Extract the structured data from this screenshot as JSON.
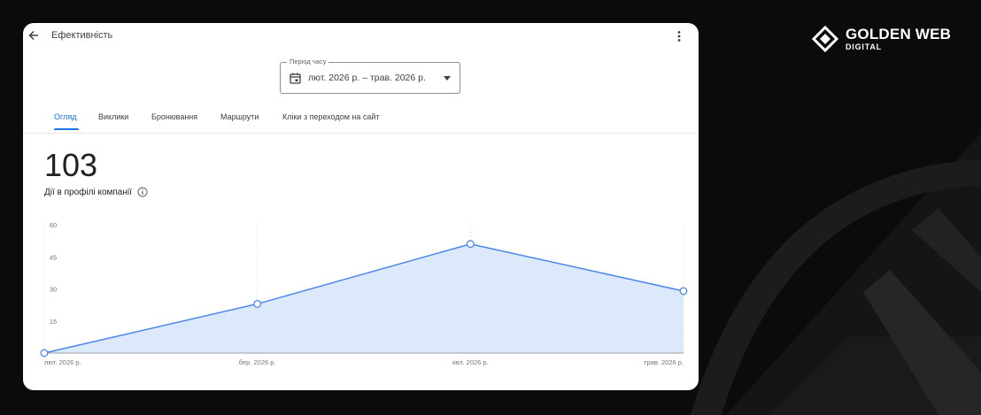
{
  "page": {
    "title": "Ефективність",
    "back_icon": "arrow-back-icon",
    "more_icon": "more-vert-icon"
  },
  "period": {
    "label": "Період часу",
    "value": "лют. 2026 р. – трав. 2026 р.",
    "icon": "calendar-icon",
    "caret": "dropdown-caret-icon"
  },
  "tabs": [
    {
      "label": "Огляд",
      "active": true
    },
    {
      "label": "Виклики",
      "active": false
    },
    {
      "label": "Бронювання",
      "active": false
    },
    {
      "label": "Маршрути",
      "active": false
    },
    {
      "label": "Кліки з переходом на сайт",
      "active": false
    }
  ],
  "metric": {
    "value": "103",
    "label": "Дії в профілі компанії",
    "info_icon": "info-icon"
  },
  "brand": {
    "name": "GOLDEN WEB",
    "sub": "DIGITAL"
  },
  "colors": {
    "accent": "#1a73e8",
    "line": "#4a86e8",
    "area_fill": "#dce9fb",
    "card_bg": "#ffffff",
    "page_bg": "#0b0b0b"
  },
  "chart_data": {
    "type": "area",
    "categories": [
      "лют. 2026 р.",
      "бер. 2026 р.",
      "квіт. 2026 р.",
      "трав. 2026 р."
    ],
    "values": [
      0,
      23,
      51,
      29
    ],
    "ylim": [
      0,
      60
    ],
    "yticks": [
      "60",
      "45",
      "30",
      "15"
    ],
    "grid": "vertical-dotted"
  }
}
